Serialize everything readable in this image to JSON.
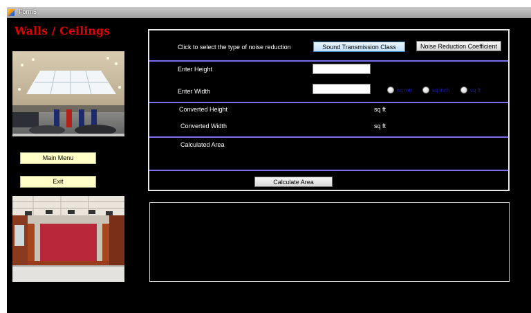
{
  "window": {
    "title": "Form5"
  },
  "sidebar": {
    "heading": "Walls / Ceilings",
    "main_menu_label": "Main Menu",
    "exit_label": "Exit"
  },
  "panel": {
    "select_prompt": "Click to select the type of noise reduction",
    "stc_button": "Sound Transmission Class",
    "nrc_button": "Noise Reduction Coefficient",
    "height_label": "Enter Height",
    "width_label": "Enter Width",
    "height_value": "",
    "width_value": "",
    "units": [
      "sq mtr",
      "sq inch",
      "sq ft"
    ],
    "converted_height_label": "Converted  Height",
    "converted_width_label": "Converted  Width",
    "converted_height_unit": "sq ft",
    "converted_width_unit": "sq ft",
    "calculated_area_label": "Calculated Area",
    "calculate_button": "Calculate Area"
  },
  "colors": {
    "heading": "#e00000",
    "divider": "#7b6ff0",
    "side_button": "#ffffc8",
    "radio_text": "#1a1aa8"
  }
}
